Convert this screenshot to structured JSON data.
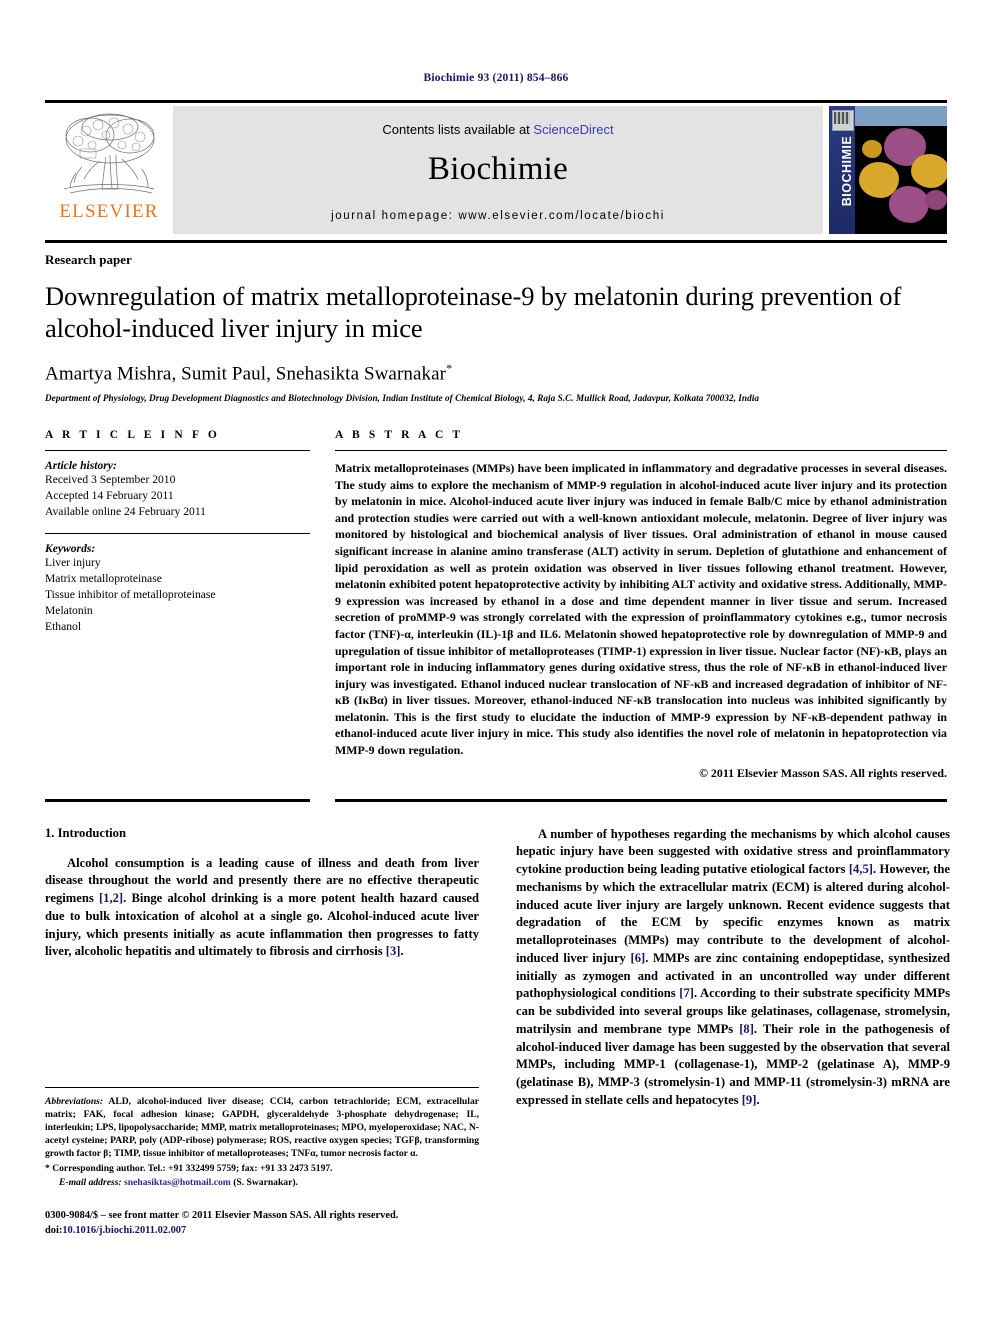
{
  "running_head": "Biochimie 93 (2011) 854–866",
  "masthead": {
    "publisher_logo_name": "ELSEVIER",
    "contents_prefix": "Contents lists available at ",
    "contents_link": "ScienceDirect",
    "journal_title": "Biochimie",
    "homepage": "journal homepage: www.elsevier.com/locate/biochi",
    "cover_spine_title": "BIOCHIMIE"
  },
  "article": {
    "doctype": "Research paper",
    "title": "Downregulation of matrix metalloproteinase-9 by melatonin during prevention of alcohol-induced liver injury in mice",
    "authors": "Amartya Mishra, Sumit Paul, Snehasikta Swarnakar",
    "corresponding_marker": "*",
    "affiliation": "Department of Physiology, Drug Development Diagnostics and Biotechnology Division, Indian Institute of Chemical Biology, 4, Raja S.C. Mullick Road, Jadavpur, Kolkata 700032, India"
  },
  "article_info": {
    "heading": "A R T I C L E   I N F O",
    "history_label": "Article history:",
    "history": [
      "Received 3 September 2010",
      "Accepted 14 February 2011",
      "Available online 24 February 2011"
    ],
    "keywords_label": "Keywords:",
    "keywords": [
      "Liver injury",
      "Matrix metalloproteinase",
      "Tissue inhibitor of metalloproteinase",
      "Melatonin",
      "Ethanol"
    ]
  },
  "abstract": {
    "heading": "A B S T R A C T",
    "text": "Matrix metalloproteinases (MMPs) have been implicated in inflammatory and degradative processes in several diseases. The study aims to explore the mechanism of MMP-9 regulation in alcohol-induced acute liver injury and its protection by melatonin in mice. Alcohol-induced acute liver injury was induced in female Balb/C mice by ethanol administration and protection studies were carried out with a well-known antioxidant molecule, melatonin. Degree of liver injury was monitored by histological and biochemical analysis of liver tissues. Oral administration of ethanol in mouse caused significant increase in alanine amino transferase (ALT) activity in serum. Depletion of glutathione and enhancement of lipid peroxidation as well as protein oxidation was observed in liver tissues following ethanol treatment. However, melatonin exhibited potent hepatoprotective activity by inhibiting ALT activity and oxidative stress. Additionally, MMP-9 expression was increased by ethanol in a dose and time dependent manner in liver tissue and serum. Increased secretion of proMMP-9 was strongly correlated with the expression of proinflammatory cytokines e.g., tumor necrosis factor (TNF)-α, interleukin (IL)-1β and IL6. Melatonin showed hepatoprotective role by downregulation of MMP-9 and upregulation of tissue inhibitor of metalloproteases (TIMP-1) expression in liver tissue. Nuclear factor (NF)-κB, plays an important role in inducing inflammatory genes during oxidative stress, thus the role of NF-κB in ethanol-induced liver injury was investigated. Ethanol induced nuclear translocation of NF-κB and increased degradation of inhibitor of NF-κB (IκBα) in liver tissues. Moreover, ethanol-induced NF-κB translocation into nucleus was inhibited significantly by melatonin. This is the first study to elucidate the induction of MMP-9 expression by NF-κB-dependent pathway in ethanol-induced acute liver injury in mice. This study also identifies the novel role of melatonin in hepatoprotection via MMP-9 down regulation.",
    "copyright": "© 2011 Elsevier Masson SAS. All rights reserved."
  },
  "introduction": {
    "heading": "1. Introduction",
    "left_paragraph_part1": "Alcohol consumption is a leading cause of illness and death from liver disease throughout the world and presently there are no effective therapeutic regimens ",
    "left_cite1": "[1,2]",
    "left_paragraph_part2": ". Binge alcohol drinking is a more potent health hazard caused due to bulk intoxication of alcohol at a single go. Alcohol-induced acute liver injury, which presents initially as acute inflammation then progresses to fatty liver, alcoholic hepatitis and ultimately to fibrosis and cirrhosis ",
    "left_cite2": "[3]",
    "left_paragraph_part3": ".",
    "right_part1": "A number of hypotheses regarding the mechanisms by which alcohol causes hepatic injury have been suggested with oxidative stress and proinflammatory cytokine production being leading putative etiological factors ",
    "right_cite1": "[4,5]",
    "right_part2": ". However, the mechanisms by which the extracellular matrix (ECM) is altered during alcohol-induced acute liver injury are largely unknown. Recent evidence suggests that degradation of the ECM by specific enzymes known as matrix metalloproteinases (MMPs) may contribute to the development of alcohol-induced liver injury ",
    "right_cite2": "[6]",
    "right_part3": ". MMPs are zinc containing endopeptidase, synthesized initially as zymogen and activated in an uncontrolled way under different pathophysiological conditions ",
    "right_cite3": "[7]",
    "right_part4": ". According to their substrate specificity MMPs can be subdivided into several groups like gelatinases, collagenase, stromelysin, matrilysin and membrane type MMPs ",
    "right_cite4": "[8]",
    "right_part5": ". Their role in the pathogenesis of alcohol-induced liver damage has been suggested by the observation that several MMPs, including MMP-1 (collagenase-1), MMP-2 (gelatinase A), MMP-9 (gelatinase B), MMP-3 (stromelysin-1) and MMP-11 (stromelysin-3) mRNA are expressed in stellate cells and hepatocytes ",
    "right_cite5": "[9]",
    "right_part6": "."
  },
  "footnotes": {
    "abbreviations_label": "Abbreviations:",
    "abbreviations_text": " ALD, alcohol-induced liver disease; CCl4, carbon tetrachloride; ECM, extracellular matrix; FAK, focal adhesion kinase; GAPDH, glyceraldehyde 3-phosphate dehydrogenase; IL, interleukin; LPS, lipopolysaccharide; MMP, matrix metalloproteinases; MPO, myeloperoxidase; NAC, N-acetyl cysteine; PARP, poly (ADP-ribose) polymerase; ROS, reactive oxygen species; TGFβ, transforming growth factor β; TIMP, tissue inhibitor of metalloproteases; TNFα, tumor necrosis factor α.",
    "corresponding": "* Corresponding author. Tel.: +91 332499 5759; fax: +91 33 2473 5197.",
    "email_label": "E-mail address:",
    "email": "snehasiktas@hotmail.com",
    "email_suffix": " (S. Swarnakar).",
    "imprint_line1": "0300-9084/$ – see front matter © 2011 Elsevier Masson SAS. All rights reserved.",
    "imprint_doi_label": "doi:",
    "imprint_doi": "10.1016/j.biochi.2011.02.007"
  },
  "colors": {
    "link_blue": "#3a3ab0",
    "cite_navy": "#141464",
    "elsevier_orange": "#E87722",
    "banner_gray": "#e3e3e3"
  }
}
